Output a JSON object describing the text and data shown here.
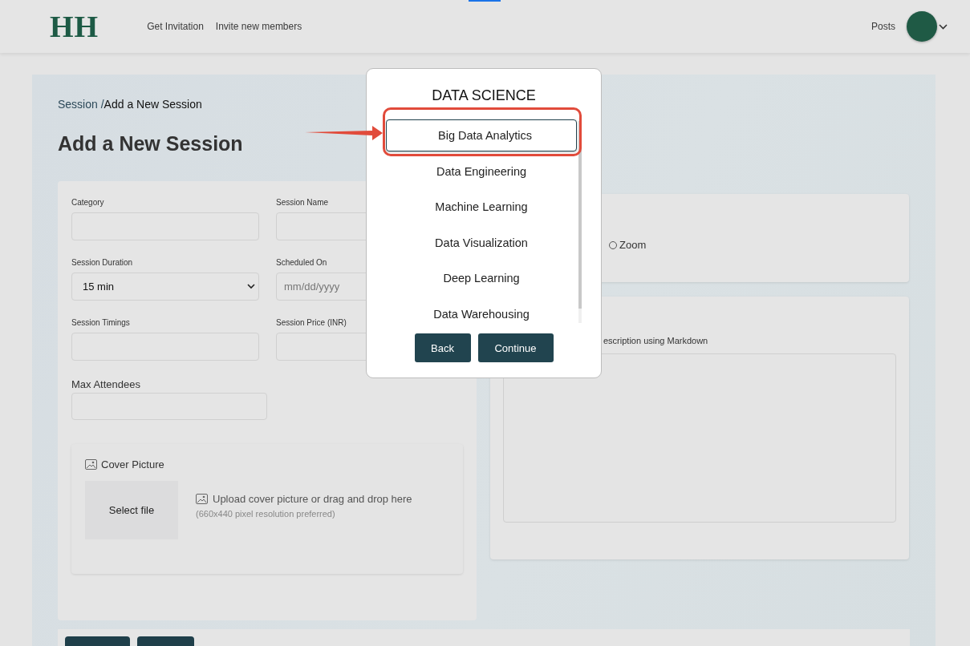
{
  "header": {
    "logo": "HH",
    "nav": [
      {
        "label": "Get Invitation"
      },
      {
        "label": "Invite new members"
      }
    ],
    "posts": "Posts"
  },
  "breadcrumb": {
    "parent": "Session /",
    "current": "Add a New Session"
  },
  "title": "Add a New Session",
  "form": {
    "fields": [
      {
        "label": "Category",
        "kind": "text"
      },
      {
        "label": "Session Name",
        "kind": "text"
      },
      {
        "label": "Session Duration",
        "kind": "select",
        "value": "15 min"
      },
      {
        "label": "Scheduled On",
        "kind": "text",
        "placeholder": "mm/dd/yyyy"
      },
      {
        "label": "Session Timings",
        "kind": "text"
      },
      {
        "label": "Session Price (INR)",
        "kind": "text"
      }
    ],
    "max_attendees": {
      "label": "Max Attendees"
    },
    "cover": {
      "title": "Cover Picture",
      "button": "Select file",
      "hint": "Upload cover picture or drag and drop here",
      "note": "(660x440 pixel resolution preferred)"
    }
  },
  "platform": {
    "options": [
      {
        "label": "Zoom",
        "selected": false
      }
    ]
  },
  "description": {
    "label": "escription using Markdown"
  },
  "modal": {
    "title": "DATA SCIENCE",
    "items": [
      {
        "label": "Big Data Analytics",
        "selected": true
      },
      {
        "label": "Data Engineering",
        "selected": false
      },
      {
        "label": "Machine Learning",
        "selected": false
      },
      {
        "label": "Data Visualization",
        "selected": false
      },
      {
        "label": "Deep Learning",
        "selected": false
      },
      {
        "label": "Data Warehousing",
        "selected": false
      }
    ],
    "buttons": [
      "Back",
      "Continue"
    ]
  }
}
